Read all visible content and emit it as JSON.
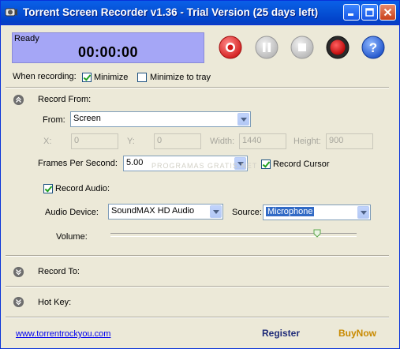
{
  "window": {
    "title": "Torrent Screen Recorder v1.36 - Trial Version (25 days left)"
  },
  "status": {
    "state": "Ready",
    "timer": "00:00:00"
  },
  "controls": {
    "record_icon": "record-icon",
    "pause_icon": "pause-icon",
    "stop_icon": "stop-icon",
    "rec_indicator_icon": "rec-indicator-icon",
    "help_icon": "help-icon"
  },
  "when_recording": {
    "label": "When recording:",
    "minimize": {
      "label": "Minimize",
      "checked": true
    },
    "minimize_tray": {
      "label": "Minimize to tray",
      "checked": false
    }
  },
  "record_from": {
    "header": "Record From:",
    "from_label": "From:",
    "from_value": "Screen",
    "x_label": "X:",
    "x_value": "0",
    "y_label": "Y:",
    "y_value": "0",
    "width_label": "Width:",
    "width_value": "1440",
    "height_label": "Height:",
    "height_value": "900",
    "fps_label": "Frames Per Second:",
    "fps_value": "5.00",
    "record_cursor": {
      "label": "Record Cursor",
      "checked": true
    },
    "record_audio": {
      "label": "Record Audio:",
      "checked": true
    },
    "audio_device_label": "Audio Device:",
    "audio_device_value": "SoundMAX HD Audio",
    "source_label": "Source:",
    "source_value": "Microphone",
    "volume_label": "Volume:",
    "volume_level": 0.84
  },
  "watermark": "PROGRAMAS GRATIS.NET",
  "sections": {
    "record_to": "Record To:",
    "hot_key": "Hot Key:"
  },
  "footer": {
    "website": "www.torrentrockyou.com",
    "register": "Register",
    "buy_now": "BuyNow"
  }
}
